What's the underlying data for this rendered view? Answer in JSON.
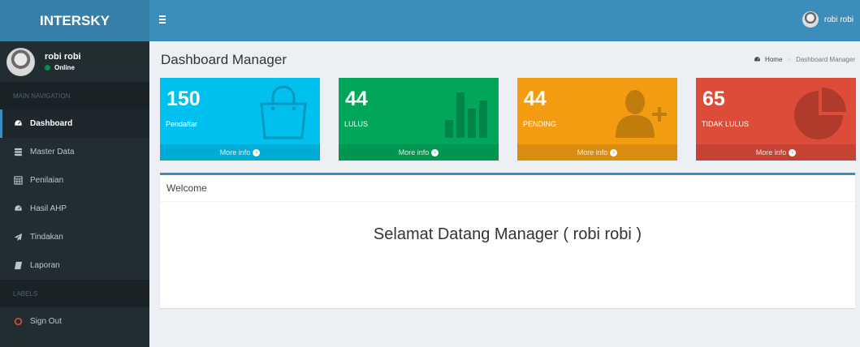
{
  "app": {
    "logo_text": "INTERSKY"
  },
  "user": {
    "name": "robi robi",
    "status": "Online"
  },
  "sidebar": {
    "main_header": "MAIN NAVIGATION",
    "labels_header": "LABELS",
    "items": [
      {
        "label": "Dashboard",
        "icon": "dashboard-icon",
        "active": true
      },
      {
        "label": "Master Data",
        "icon": "database-icon"
      },
      {
        "label": "Penilaian",
        "icon": "calculator-icon"
      },
      {
        "label": "Hasil AHP",
        "icon": "dashboard-icon"
      },
      {
        "label": "Tindakan",
        "icon": "paper-plane-icon"
      },
      {
        "label": "Laporan",
        "icon": "book-icon"
      }
    ],
    "signout": {
      "label": "Sign Out",
      "icon": "circle-o-icon",
      "color": "#dd4b39"
    }
  },
  "topbar": {
    "toggle_icon": "menu-icon",
    "username": "robi robi"
  },
  "page": {
    "title": "Dashboard Manager",
    "breadcrumb": {
      "home": "Home",
      "current": "Dashboard Manager"
    }
  },
  "stats": [
    {
      "value": "150",
      "label": "Pendaftar",
      "footer": "More info",
      "color": "#00c0ef",
      "icon": "shopping-bag-icon"
    },
    {
      "value": "44",
      "label": "LULUS",
      "footer": "More info",
      "color": "#00a65a",
      "icon": "bar-chart-icon"
    },
    {
      "value": "44",
      "label": "PENDING",
      "footer": "More info",
      "color": "#f39c12",
      "icon": "user-plus-icon"
    },
    {
      "value": "65",
      "label": "TIDAK LULUS",
      "footer": "More info",
      "color": "#dd4b39",
      "icon": "pie-chart-icon"
    }
  ],
  "welcome": {
    "header": "Welcome",
    "message": "Selamat Datang Manager ( robi robi )"
  },
  "colors": {
    "sidebar": "#222d32",
    "topbar": "#3c8dbc",
    "logo": "#367fa9",
    "background": "#ecf0f5"
  }
}
